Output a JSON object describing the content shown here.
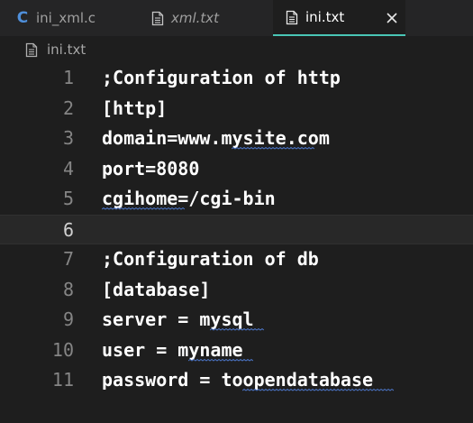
{
  "tabs": [
    {
      "label": "ini_xml.c",
      "icon": "c-file-icon"
    },
    {
      "label": "xml.txt",
      "icon": "text-file-icon"
    },
    {
      "label": "ini.txt",
      "icon": "text-file-icon"
    }
  ],
  "breadcrumb": {
    "label": "ini.txt",
    "icon": "text-file-icon"
  },
  "editor": {
    "current_line": 6,
    "lines": [
      {
        "num": "1",
        "text": ";Configuration of http"
      },
      {
        "num": "2",
        "text": "[http]"
      },
      {
        "num": "3",
        "text": "domain=www.mysite.com"
      },
      {
        "num": "4",
        "text": "port=8080"
      },
      {
        "num": "5",
        "text": "cgihome=/cgi-bin"
      },
      {
        "num": "6",
        "text": ""
      },
      {
        "num": "7",
        "text": ";Configuration of db"
      },
      {
        "num": "8",
        "text": "[database]"
      },
      {
        "num": "9",
        "text": "server = mysql"
      },
      {
        "num": "10",
        "text": "user = myname"
      },
      {
        "num": "11",
        "text": "password = toopendatabase"
      }
    ]
  },
  "colors": {
    "active_tab_border": "#49c5b6",
    "c_icon": "#4f8fda",
    "squiggle": "#4d78cc"
  }
}
